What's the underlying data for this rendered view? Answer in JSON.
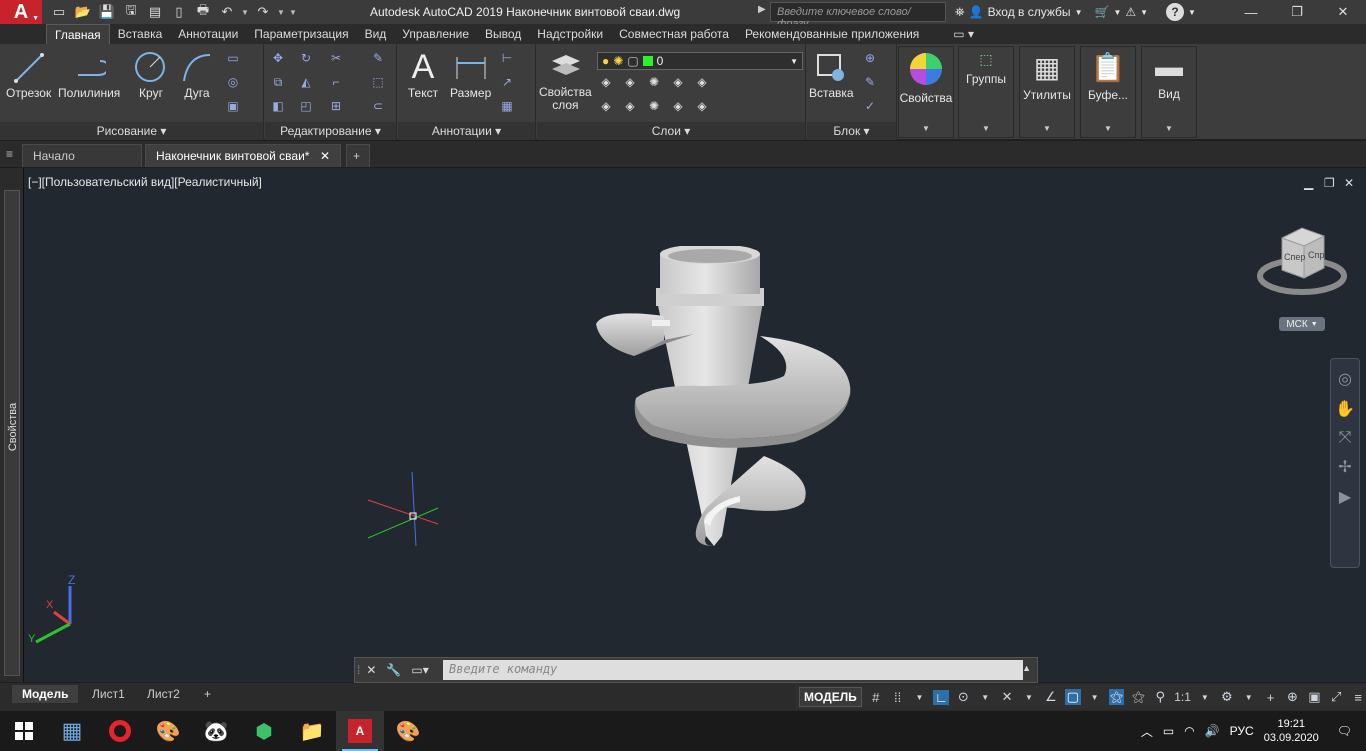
{
  "titlebar": {
    "logo": "A",
    "title": "Autodesk AutoCAD 2019    Наконечник винтовой сваи.dwg",
    "search_placeholder": "Введите ключевое слово/фразу",
    "signin_label": "Вход в службы"
  },
  "ribbon_tabs": [
    "Главная",
    "Вставка",
    "Аннотации",
    "Параметризация",
    "Вид",
    "Управление",
    "Вывод",
    "Надстройки",
    "Совместная работа",
    "Рекомендованные приложения"
  ],
  "ribbon": {
    "draw": {
      "title": "Рисование",
      "line": "Отрезок",
      "polyline": "Полилиния",
      "circle": "Круг",
      "arc": "Дуга"
    },
    "modify": {
      "title": "Редактирование"
    },
    "annotation": {
      "title": "Аннотации",
      "text": "Текст",
      "dimension": "Размер"
    },
    "layers": {
      "title": "Слои",
      "props_l1": "Свойства",
      "props_l2": "слоя",
      "current_layer": "0"
    },
    "block": {
      "title": "Блок",
      "insert": "Вставка"
    },
    "properties": "Свойства",
    "groups": "Группы",
    "utilities": "Утилиты",
    "clipboard": "Буфе...",
    "view": "Вид"
  },
  "doc_tabs": [
    "Начало",
    "Наконечник винтовой сваи*"
  ],
  "viewport": {
    "label": "[−][Пользовательский вид][Реалистичный]",
    "ucs_label": "МСК",
    "cube_face_front": "Спер",
    "cube_face_right": "Спр"
  },
  "side_panel": {
    "label": "Свойства"
  },
  "command": {
    "placeholder": "Введите команду"
  },
  "layout_tabs": [
    "Модель",
    "Лист1",
    "Лист2"
  ],
  "status": {
    "model": "МОДЕЛЬ",
    "scale": "1:1"
  },
  "taskbar": {
    "lang": "РУС",
    "time": "19:21",
    "date": "03.09.2020"
  },
  "colors": {
    "accent": "#c8222c",
    "bg": "#212830",
    "ribbon": "#3d3d3d"
  }
}
